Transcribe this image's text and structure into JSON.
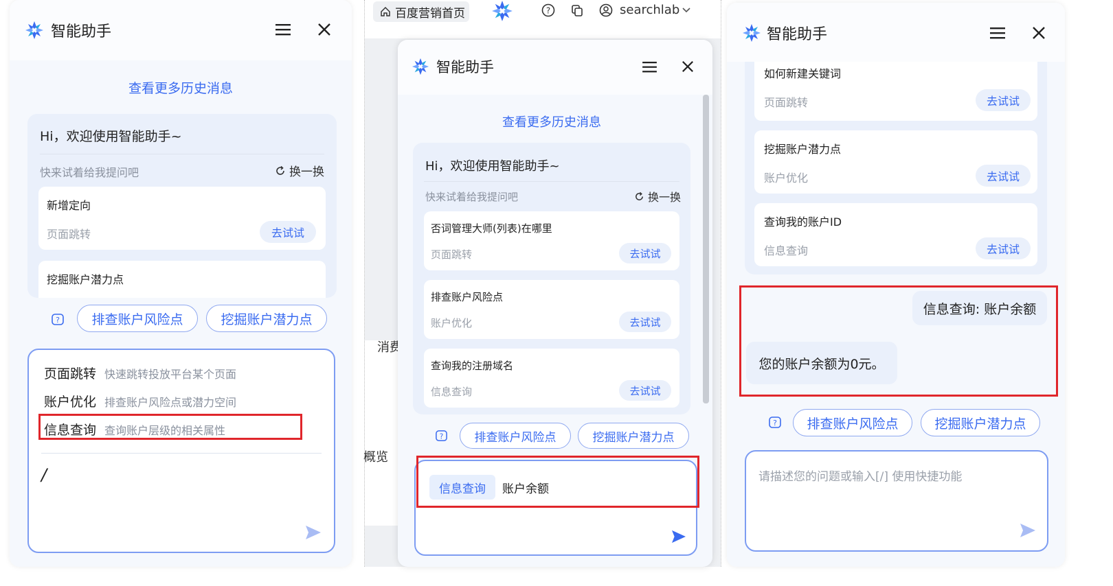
{
  "assistant": {
    "title": "智能助手",
    "history_link": "查看更多历史消息",
    "greeting": "Hi，欢迎使用智能助手~",
    "suggest_label": "快来试着给我提问吧",
    "refresh_label": "换一换",
    "try_label": "去试试"
  },
  "panel1": {
    "items": [
      {
        "title": "新增定向",
        "category": "页面跳转"
      },
      {
        "title": "挖掘账户潜力点",
        "category": ""
      }
    ],
    "chips": [
      "排查账户风险点",
      "挖掘账户潜力点"
    ],
    "shortcut_menu": [
      {
        "name": "页面跳转",
        "desc": "快速跳转投放平台某个页面"
      },
      {
        "name": "账户优化",
        "desc": "排查账户风险点或潜力空间"
      },
      {
        "name": "信息查询",
        "desc": "查询账户层级的相关属性"
      }
    ],
    "input_value": "/"
  },
  "panel2": {
    "topbar": {
      "home_label": "百度营销首页",
      "user_name": "searchlab"
    },
    "background": {
      "text1": "消费",
      "text2": "概览"
    },
    "items": [
      {
        "title": "否词管理大师(列表)在哪里",
        "category": "页面跳转"
      },
      {
        "title": "排查账户风险点",
        "category": "账户优化"
      },
      {
        "title": "查询我的注册域名",
        "category": "信息查询"
      }
    ],
    "chips": [
      "排查账户风险点",
      "挖掘账户潜力点"
    ],
    "input_tag": "信息查询",
    "input_value": "账户余额"
  },
  "panel3": {
    "items": [
      {
        "title": "如何新建关键词",
        "category": "页面跳转"
      },
      {
        "title": "挖掘账户潜力点",
        "category": "账户优化"
      },
      {
        "title": "查询我的账户ID",
        "category": "信息查询"
      }
    ],
    "user_message": "信息查询: 账户余额",
    "bot_reply": "您的账户余额为0元。",
    "chips": [
      "排查账户风险点",
      "挖掘账户潜力点"
    ],
    "input_placeholder": "请描述您的问题或输入[/] 使用快捷功能"
  },
  "colors": {
    "accent": "#3a6bf0",
    "highlight_box": "#e0262b",
    "panel_bg": "#f5f8fd"
  }
}
